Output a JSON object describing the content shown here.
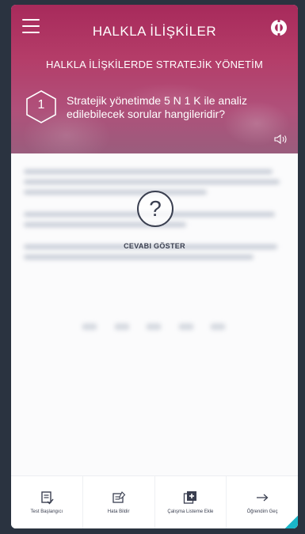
{
  "header": {
    "title": "HALKLA İLİŞKİLER",
    "subtitle": "HALKLA İLİŞKİLERDE STRATEJİK YÖNETİM"
  },
  "question": {
    "number": "1",
    "text": "Stratejik yönetimde 5 N 1 K ile analiz edilebilecek sorular hangileridir?"
  },
  "answer": {
    "icon_symbol": "?",
    "reveal_label": "CEVABI GÖSTER"
  },
  "toolbar": {
    "items": [
      {
        "label": "Test Başlangıcı",
        "icon": "test-start-icon"
      },
      {
        "label": "Hata Bildir",
        "icon": "report-error-icon"
      },
      {
        "label": "Çalışma Listeme Ekle",
        "icon": "add-study-list-icon"
      },
      {
        "label": "Öğrendim Geç",
        "icon": "arrow-right-icon"
      }
    ]
  },
  "colors": {
    "header_top": "#a72a5b",
    "header_bottom": "#9a5d7d",
    "text_dark": "#3a3f50",
    "accent": "#19b6c9"
  }
}
